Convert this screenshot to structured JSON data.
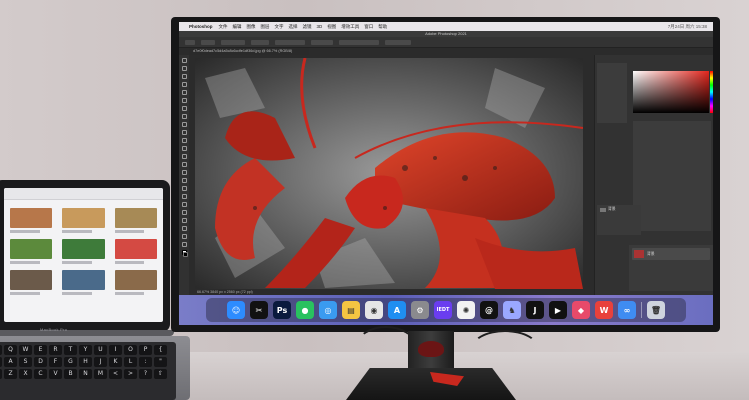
{
  "menubar": {
    "app_name": "Photoshop",
    "items": [
      "文件",
      "编辑",
      "图像",
      "图层",
      "文字",
      "选择",
      "滤镜",
      "3D",
      "视图",
      "增效工具",
      "窗口",
      "帮助"
    ],
    "clock": "7月24日 周六 15:38"
  },
  "window": {
    "title": "Adobe Photoshop 2021"
  },
  "document": {
    "tab_label": "d7e0f0dead7c5d4a5c8c6cdfe1df36d.jpg @ 66.7% (RGB/8)",
    "zoom": "66.67%",
    "status": "66.67%   3840 px x 2560 px (72 ppi)"
  },
  "panels": {
    "layer_name": "背景"
  },
  "dock": {
    "apps": [
      {
        "name": "finder",
        "glyph": "☺",
        "color": "#2d8cff"
      },
      {
        "name": "capcut",
        "glyph": "✂",
        "color": "#111111"
      },
      {
        "name": "photoshop",
        "glyph": "Ps",
        "color": "#0a1a3d"
      },
      {
        "name": "wechat",
        "glyph": "●",
        "color": "#29c15f"
      },
      {
        "name": "safari",
        "glyph": "◎",
        "color": "#3a9bf0"
      },
      {
        "name": "notes-app",
        "glyph": "▤",
        "color": "#f4c542"
      },
      {
        "name": "chrome",
        "glyph": "◉",
        "color": "#e6e6e6"
      },
      {
        "name": "app-store",
        "glyph": "A",
        "color": "#1f8ef1"
      },
      {
        "name": "settings",
        "glyph": "⚙",
        "color": "#8a8a8e"
      },
      {
        "name": "ieditor",
        "glyph": "IEDT",
        "color": "#6a3df0"
      },
      {
        "name": "chatgpt",
        "glyph": "✺",
        "color": "#f2f2f2"
      },
      {
        "name": "threads",
        "glyph": "@",
        "color": "#111111"
      },
      {
        "name": "vpn",
        "glyph": "♞",
        "color": "#9aa8ff"
      },
      {
        "name": "jetbrains",
        "glyph": "J",
        "color": "#111111"
      },
      {
        "name": "facetime",
        "glyph": "▶",
        "color": "#111111"
      },
      {
        "name": "pockity",
        "glyph": "◆",
        "color": "#e84a6a"
      },
      {
        "name": "wps",
        "glyph": "W",
        "color": "#e8413c"
      },
      {
        "name": "baidu-netdisk",
        "glyph": "∞",
        "color": "#3f8cf2"
      },
      {
        "name": "trash",
        "glyph": "🗑",
        "color": "#cfd4de"
      }
    ]
  },
  "laptop": {
    "label": "MacBook Pro",
    "keys_row1": [
      "⇥",
      "Q",
      "W",
      "E",
      "R",
      "T",
      "Y",
      "U",
      "I",
      "O",
      "P",
      "{"
    ],
    "keys_row2": [
      "⇪",
      "A",
      "S",
      "D",
      "F",
      "G",
      "H",
      "J",
      "K",
      "L",
      ":",
      "\""
    ],
    "keys_row3": [
      "⇧",
      "Z",
      "X",
      "C",
      "V",
      "B",
      "N",
      "M",
      "<",
      ">",
      "?",
      "⇧"
    ],
    "thumbnail_colors": [
      "#b7774a",
      "#c89a5c",
      "#a78a56",
      "#5c8a3c",
      "#3e7b3a",
      "#d44a43",
      "#6b5a4a",
      "#4a6a8a",
      "#8a6a4a"
    ]
  },
  "colors": {
    "lobster_red": "#c8281e",
    "photoshop_blue": "#31a8ff",
    "wallpaper": "#6d70c4"
  }
}
